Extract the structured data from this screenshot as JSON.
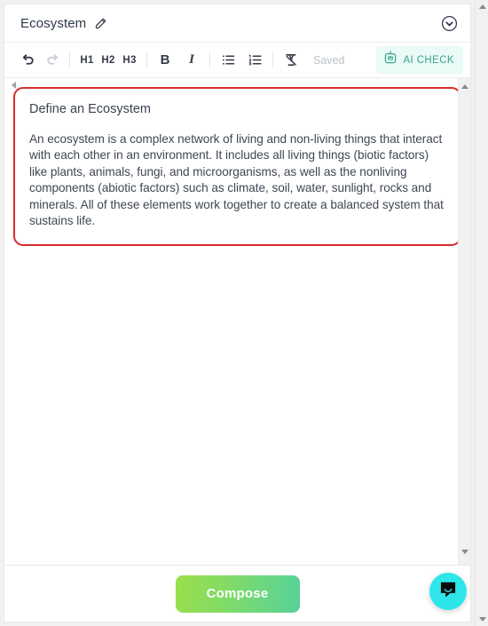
{
  "document": {
    "title": "Ecosystem",
    "edit_icon": "pencil-icon",
    "collapse_icon": "chevron-down-circle-icon"
  },
  "toolbar": {
    "undo_label": "Undo",
    "redo_label": "Redo",
    "h1_label": "H1",
    "h2_label": "H2",
    "h3_label": "H3",
    "bold_label": "B",
    "italic_label": "I",
    "bullet_list_label": "Bullet list",
    "numbered_list_label": "Numbered list",
    "clear_format_label": "Clear formatting",
    "status_label": "Saved",
    "ai_check": {
      "label": "AI CHECK",
      "icon": "robot-icon",
      "accent_color": "#3aa38b",
      "background_color": "#eafaf6"
    }
  },
  "editor": {
    "selection_border_color": "#d82b2b",
    "block": {
      "heading": "Define an Ecosystem",
      "paragraph": "An ecosystem is a complex network of living and non-living things that interact with each other in an environment. It includes all living things (biotic factors) like plants, animals, fungi, and microorganisms, as well as the nonliving components (abiotic factors) such as climate, soil, water, sunlight, rocks and minerals. All of these elements work together to create a balanced system that sustains life."
    }
  },
  "footer": {
    "compose_label": "Compose",
    "compose_gradient_from": "#9ade4a",
    "compose_gradient_to": "#55d29a"
  },
  "support": {
    "launcher_icon": "chat-bubble-icon",
    "launcher_color": "#2ee6ea"
  }
}
